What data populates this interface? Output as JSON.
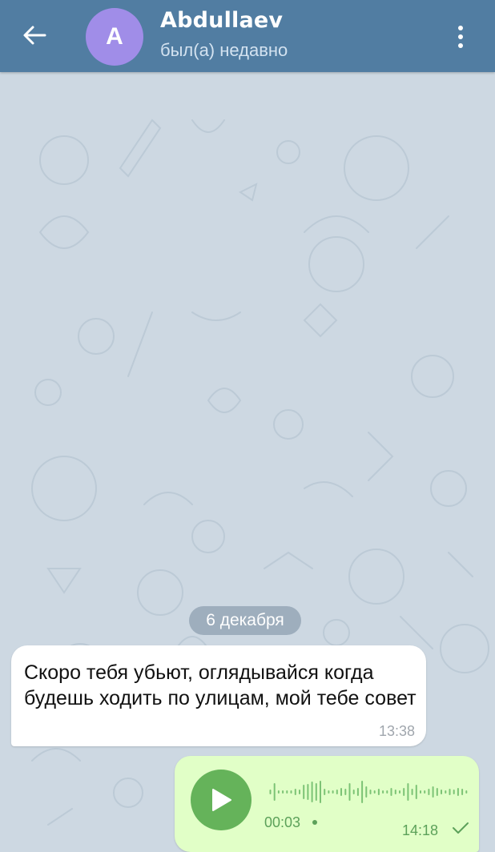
{
  "header": {
    "avatar_letter": "A",
    "title": "Abdullaev",
    "status": "был(а) недавно",
    "header_color": "#517da2",
    "avatar_color": "#a08de8"
  },
  "chat": {
    "date_separator": "6 декабря",
    "messages": [
      {
        "direction": "incoming",
        "text": "Скоро тебя убьют, оглядывайся когда будешь ходить по улицам, мой тебе совет",
        "time": "13:38"
      },
      {
        "direction": "outgoing",
        "type": "voice",
        "duration": "00:03",
        "time": "14:18",
        "status_icon": "check-icon"
      }
    ]
  },
  "icons": {
    "back": "back-arrow-icon",
    "menu": "more-vertical-icon",
    "play": "play-icon"
  },
  "colors": {
    "wallpaper": "#cdd8e2",
    "incoming_bubble": "#ffffff",
    "outgoing_bubble": "#e1ffc7",
    "accent_green": "#65b35a"
  }
}
